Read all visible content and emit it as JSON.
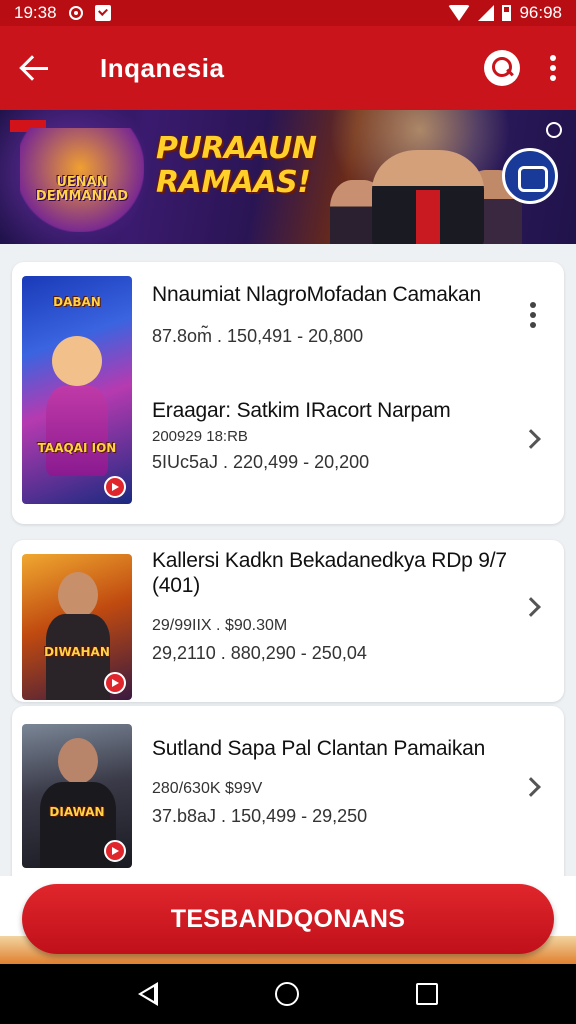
{
  "status_bar": {
    "time": "19:38",
    "right_time": "96:98"
  },
  "app_bar": {
    "title": "Inqanesia",
    "back_icon": "arrow-back-icon",
    "search_icon": "search-icon",
    "menu_icon": "more-vert-icon"
  },
  "banner": {
    "logo_text": "UENAN DEMMANIAD",
    "headline": "PURAAUN RAMAAS!"
  },
  "items": [
    {
      "title": "Nnaumiat NlagroMofadan Camakan",
      "meta": "87.8om̃ . 150,491 - 20,800",
      "thumb_caption_top": "DABAN",
      "thumb_caption_bottom": "TAAQAI ION"
    },
    {
      "title": "Eraagar: Satkim IRacort Narpam",
      "sub": "200929 18:RB",
      "meta": "5IUc5aJ . 220,499 - 20,200"
    },
    {
      "title": "Kallersi Kadkn Bekadanedkya RDp 9/7 (401)",
      "sub": "29/99IIX . $90.30M",
      "meta": "29,2110 . 880,290 - 250,04",
      "thumb_caption": "DIWAHAN"
    },
    {
      "title": "Sutland Sapa Pal Clantan Pamaikan",
      "sub": "280/630K $99V",
      "meta": "37.b8aJ . 150,499 - 29,250",
      "thumb_caption": "DIAWAN"
    }
  ],
  "cta": {
    "label": "TESBANDQONANS"
  },
  "colors": {
    "primary": "#c8141a",
    "status_bar": "#b80d12",
    "background": "#eef1f4"
  }
}
